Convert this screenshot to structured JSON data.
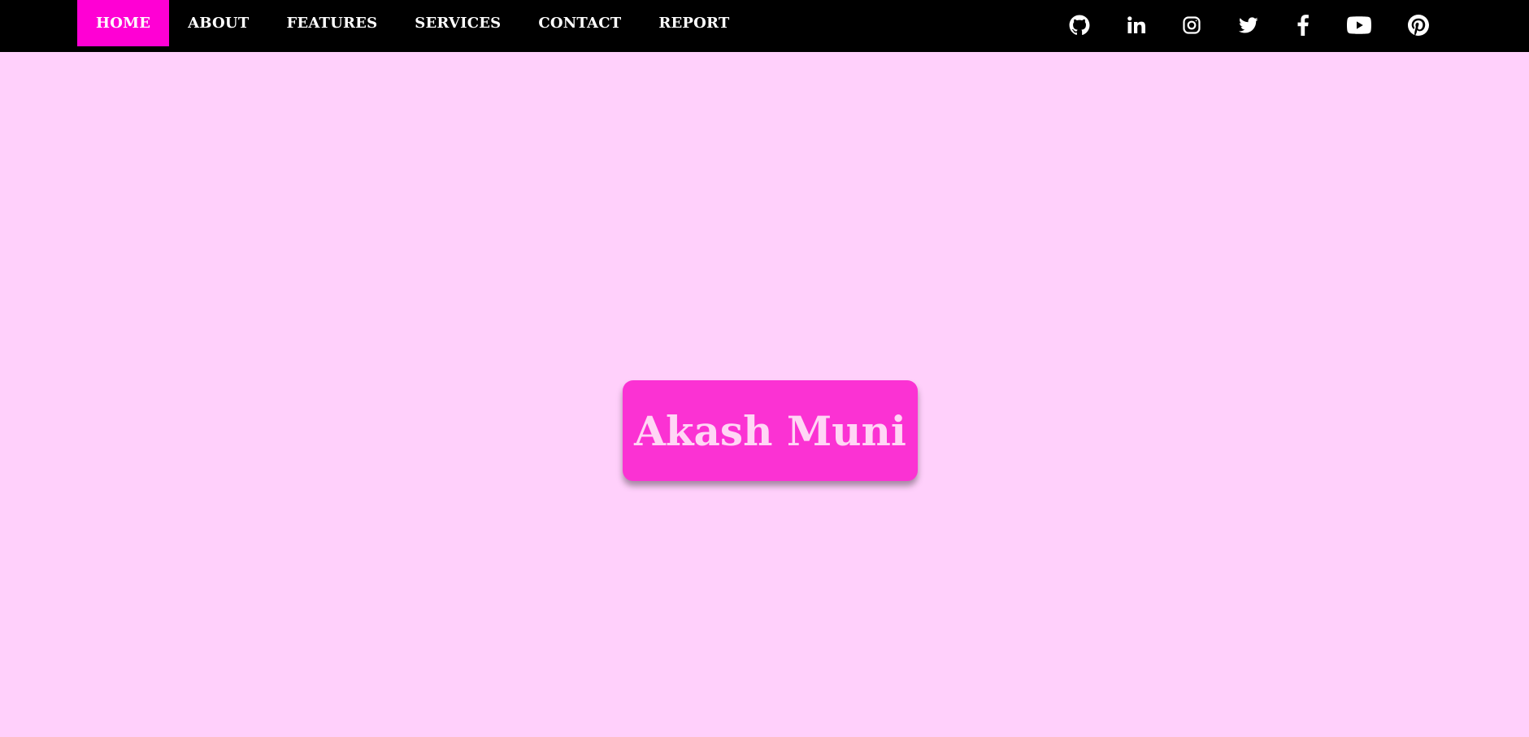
{
  "nav": {
    "items": [
      {
        "label": "HOME",
        "active": true
      },
      {
        "label": "ABOUT",
        "active": false
      },
      {
        "label": "FEATURES",
        "active": false
      },
      {
        "label": "SERVICES",
        "active": false
      },
      {
        "label": "CONTACT",
        "active": false
      },
      {
        "label": "REPORT",
        "active": false
      }
    ]
  },
  "social": [
    {
      "name": "github-icon"
    },
    {
      "name": "linkedin-icon"
    },
    {
      "name": "instagram-icon"
    },
    {
      "name": "twitter-icon"
    },
    {
      "name": "facebook-icon"
    },
    {
      "name": "youtube-icon"
    },
    {
      "name": "pinterest-icon"
    }
  ],
  "hero": {
    "name": "Akash Muni"
  },
  "colors": {
    "background": "#ffd0fb",
    "navbar": "#000000",
    "active_tab": "#ff00d4",
    "hero_box": "#fb32d3",
    "hero_text": "#ffd6f5"
  }
}
